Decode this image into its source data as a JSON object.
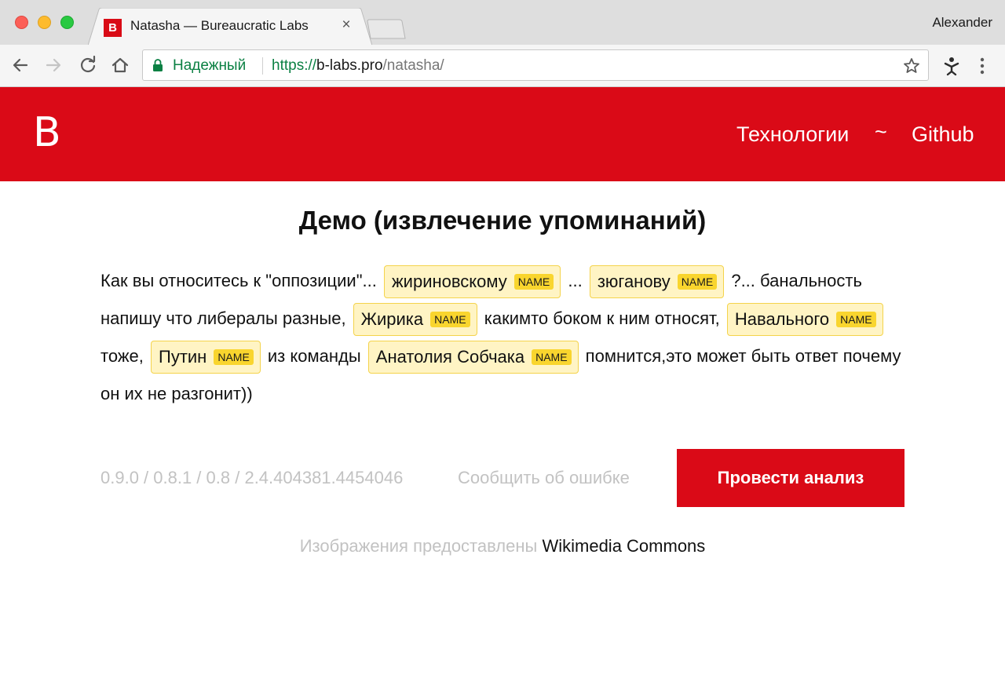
{
  "browser": {
    "tab": {
      "favicon_letter": "B",
      "title": "Natasha — Bureaucratic Labs",
      "close_glyph": "×"
    },
    "profile_name": "Alexander",
    "omnibox": {
      "secure_label": "Надежный",
      "url_scheme": "https://",
      "url_host": "b-labs.pro",
      "url_path": "/natasha/"
    },
    "icons": {
      "back": "back-arrow-icon",
      "forward": "forward-arrow-icon",
      "reload": "reload-icon",
      "home": "home-icon",
      "lock": "lock-icon",
      "bookmark": "star-icon",
      "extension": "extension-icon",
      "menu": "kebab-menu-icon"
    },
    "colors": {
      "secure_green": "#0b8043",
      "brand_red": "#da0a17",
      "mention_bg": "#fff4c4",
      "mention_badge": "#f9d52e"
    }
  },
  "site": {
    "logo": "B",
    "nav": {
      "technologies": "Технологии",
      "separator": "~",
      "github": "Github"
    }
  },
  "demo": {
    "title": "Демо (извлечение упоминаний)",
    "segments": [
      {
        "text": "Как вы относитесь к \"оппозиции\"... "
      },
      {
        "mention": "жириновскому",
        "type": "NAME"
      },
      {
        "text": " ... "
      },
      {
        "mention": "зюганову",
        "type": "NAME"
      },
      {
        "text": " ?... банальность напишу что либералы разные, "
      },
      {
        "mention": "Жирика",
        "type": "NAME"
      },
      {
        "text": " какимто боком к ним относят, "
      },
      {
        "mention": "Навального",
        "type": "NAME"
      },
      {
        "text": " тоже, "
      },
      {
        "mention": "Путин",
        "type": "NAME"
      },
      {
        "text": " из команды "
      },
      {
        "mention": "Анатолия Собчака",
        "type": "NAME"
      },
      {
        "text": " помнится,это может быть ответ почему он их не разгонит))"
      }
    ],
    "versions": "0.9.0 / 0.8.1 / 0.8 / 2.4.404381.4454046",
    "report_link": "Сообщить об ошибке",
    "analyze_button": "Провести анализ",
    "credits_prefix": "Изображения предоставлены",
    "credits_source": "Wikimedia Commons"
  }
}
